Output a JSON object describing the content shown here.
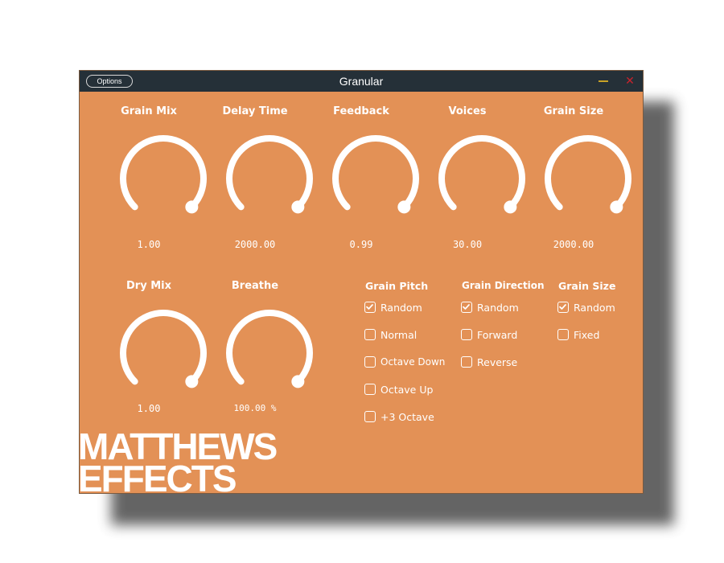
{
  "window": {
    "title": "Granular",
    "options_label": "Options",
    "minimize_icon": "minimize-icon",
    "close_icon": "close-icon",
    "close_glyph": "✕"
  },
  "knobs": [
    {
      "label": "Grain Mix",
      "value": "1.00"
    },
    {
      "label": "Delay Time",
      "value": "2000.00"
    },
    {
      "label": "Feedback",
      "value": "0.99"
    },
    {
      "label": "Voices",
      "value": "30.00"
    },
    {
      "label": "Grain Size",
      "value": "2000.00"
    },
    {
      "label": "Dry Mix",
      "value": "1.00"
    },
    {
      "label": "Breathe",
      "value": "100.00 %"
    }
  ],
  "groups": {
    "grain_pitch": {
      "title": "Grain Pitch",
      "options": [
        {
          "label": "Random",
          "checked": true
        },
        {
          "label": "Normal",
          "checked": false
        },
        {
          "label": "Octave Down",
          "checked": false
        },
        {
          "label": "Octave Up",
          "checked": false
        },
        {
          "label": "+3 Octave",
          "checked": false
        }
      ]
    },
    "grain_direction": {
      "title": "Grain Direction",
      "options": [
        {
          "label": "Random",
          "checked": true
        },
        {
          "label": "Forward",
          "checked": false
        },
        {
          "label": "Reverse",
          "checked": false
        }
      ]
    },
    "grain_size": {
      "title": "Grain Size",
      "options": [
        {
          "label": "Random",
          "checked": true
        },
        {
          "label": "Fixed",
          "checked": false
        }
      ]
    }
  },
  "brand": {
    "line1": "MATTHEWS",
    "line2": "EFFECTS"
  },
  "colors": {
    "background": "#e39156",
    "titlebar": "#253038",
    "foreground": "#ffffff",
    "close": "#c8232c",
    "minimize": "#c9a227"
  }
}
